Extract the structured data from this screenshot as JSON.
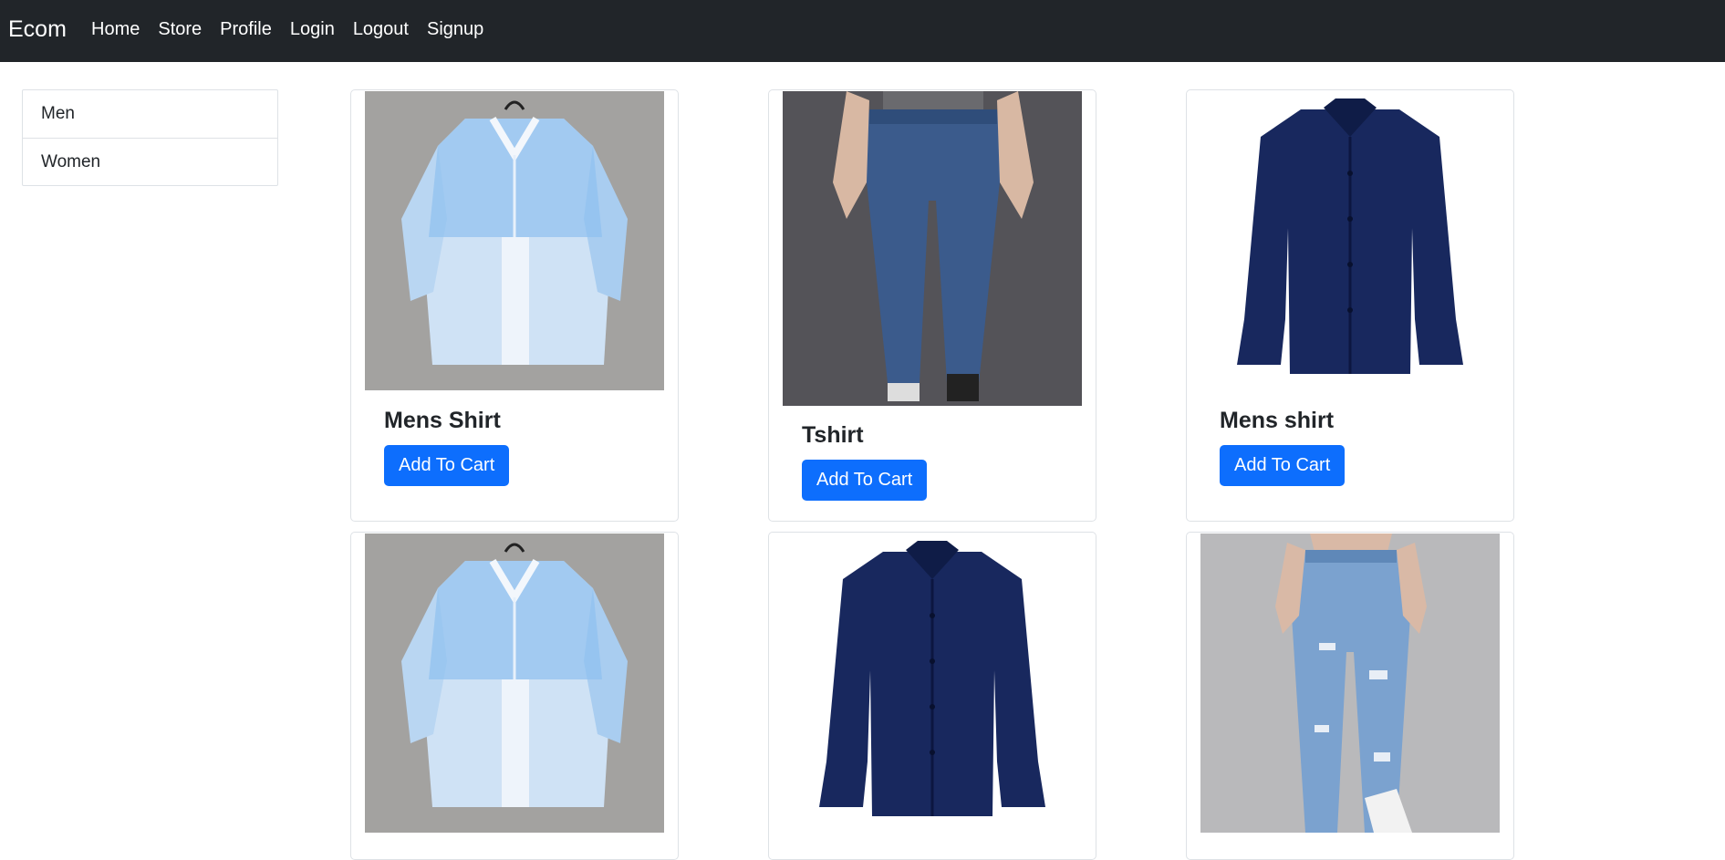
{
  "navbar": {
    "brand": "Ecom",
    "links": [
      "Home",
      "Store",
      "Profile",
      "Login",
      "Logout",
      "Signup"
    ]
  },
  "sidebar": {
    "items": [
      "Men",
      "Women"
    ]
  },
  "products": [
    {
      "title": "Mens Shirt",
      "button": "Add To Cart",
      "image": "light-blue-shirt"
    },
    {
      "title": "Tshirt",
      "button": "Add To Cart",
      "image": "dark-blue-jeans"
    },
    {
      "title": "Mens shirt",
      "button": "Add To Cart",
      "image": "navy-shirt"
    },
    {
      "title": "",
      "button": "",
      "image": "light-blue-shirt"
    },
    {
      "title": "",
      "button": "",
      "image": "navy-shirt"
    },
    {
      "title": "",
      "button": "",
      "image": "ripped-jeans"
    }
  ],
  "colors": {
    "navbar_bg": "#212529",
    "primary": "#0d6efd",
    "border": "#dee2e6",
    "text": "#212529"
  }
}
